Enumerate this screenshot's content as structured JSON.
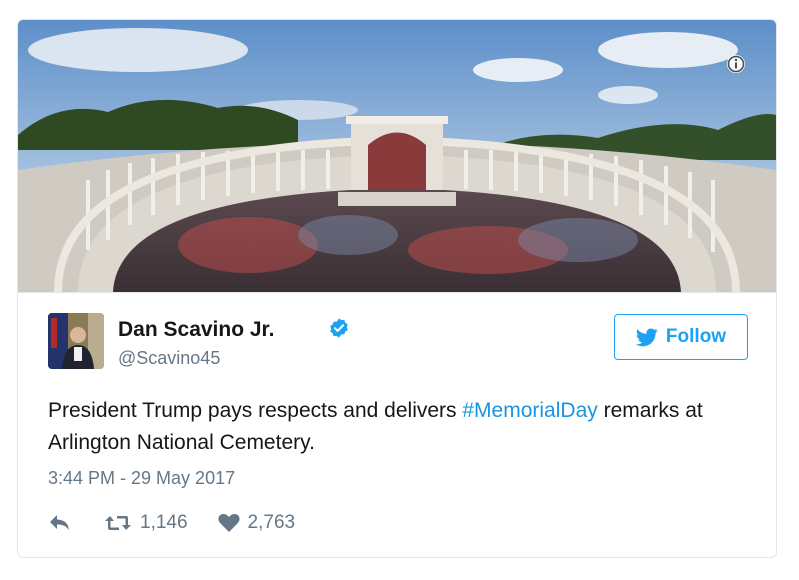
{
  "tweet": {
    "author": {
      "name": "Dan Scavino Jr.",
      "handle": "@Scavino45",
      "verified": true,
      "avatar_icon": "profile-photo"
    },
    "follow_label": "Follow",
    "text_before": "President Trump pays respects and delivers ",
    "hashtag": "#MemorialDay",
    "text_after": " remarks at Arlington National Cemetery.",
    "timestamp": "3:44 PM - 29 May 2017",
    "retweet_count": "1,146",
    "like_count": "2,763",
    "media": {
      "info_icon": "info-icon"
    }
  },
  "colors": {
    "brand_blue": "#1da1f2",
    "hashtag_blue": "#1b95e0",
    "text": "#14171a",
    "muted": "#657786",
    "border": "#e1e8ed"
  }
}
